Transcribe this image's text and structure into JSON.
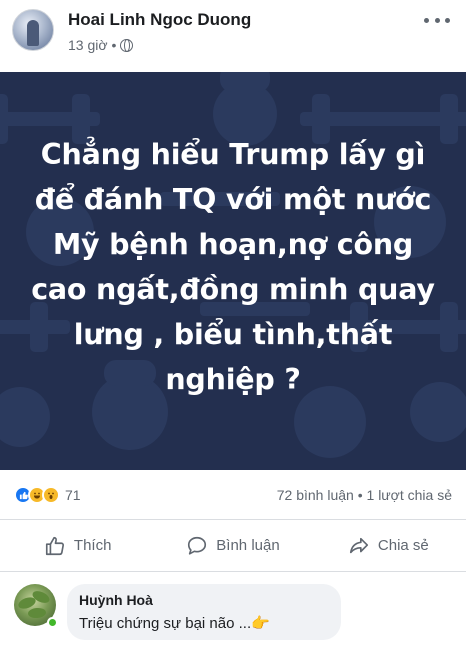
{
  "post": {
    "author": "Hoai Linh Ngoc Duong",
    "time": "13 giờ",
    "separator": "•",
    "privacy_icon": "globe-icon",
    "more_icon": "more-options-icon",
    "image_text": "Chẳng hiểu Trump lấy gì để đánh TQ với một nước Mỹ bệnh hoạn,nợ công cao ngất,đồng minh quay lưng , biểu tình,thất nghiệp ?",
    "image_bg_color": "#232f4f"
  },
  "stats": {
    "reaction_icons": [
      "like-icon",
      "haha-icon",
      "wow-icon"
    ],
    "reaction_count": "71",
    "comments": "72 bình luận",
    "dot": "•",
    "shares": "1 lượt chia sẻ"
  },
  "actions": {
    "like_label": "Thích",
    "comment_label": "Bình luận",
    "share_label": "Chia sẻ"
  },
  "comment": {
    "author": "Huỳnh Hoà",
    "text": "Triệu chứng sự  bại não ...👉"
  },
  "colors": {
    "accent": "#1877f2",
    "secondary_text": "#606770",
    "online": "#42b72a"
  }
}
